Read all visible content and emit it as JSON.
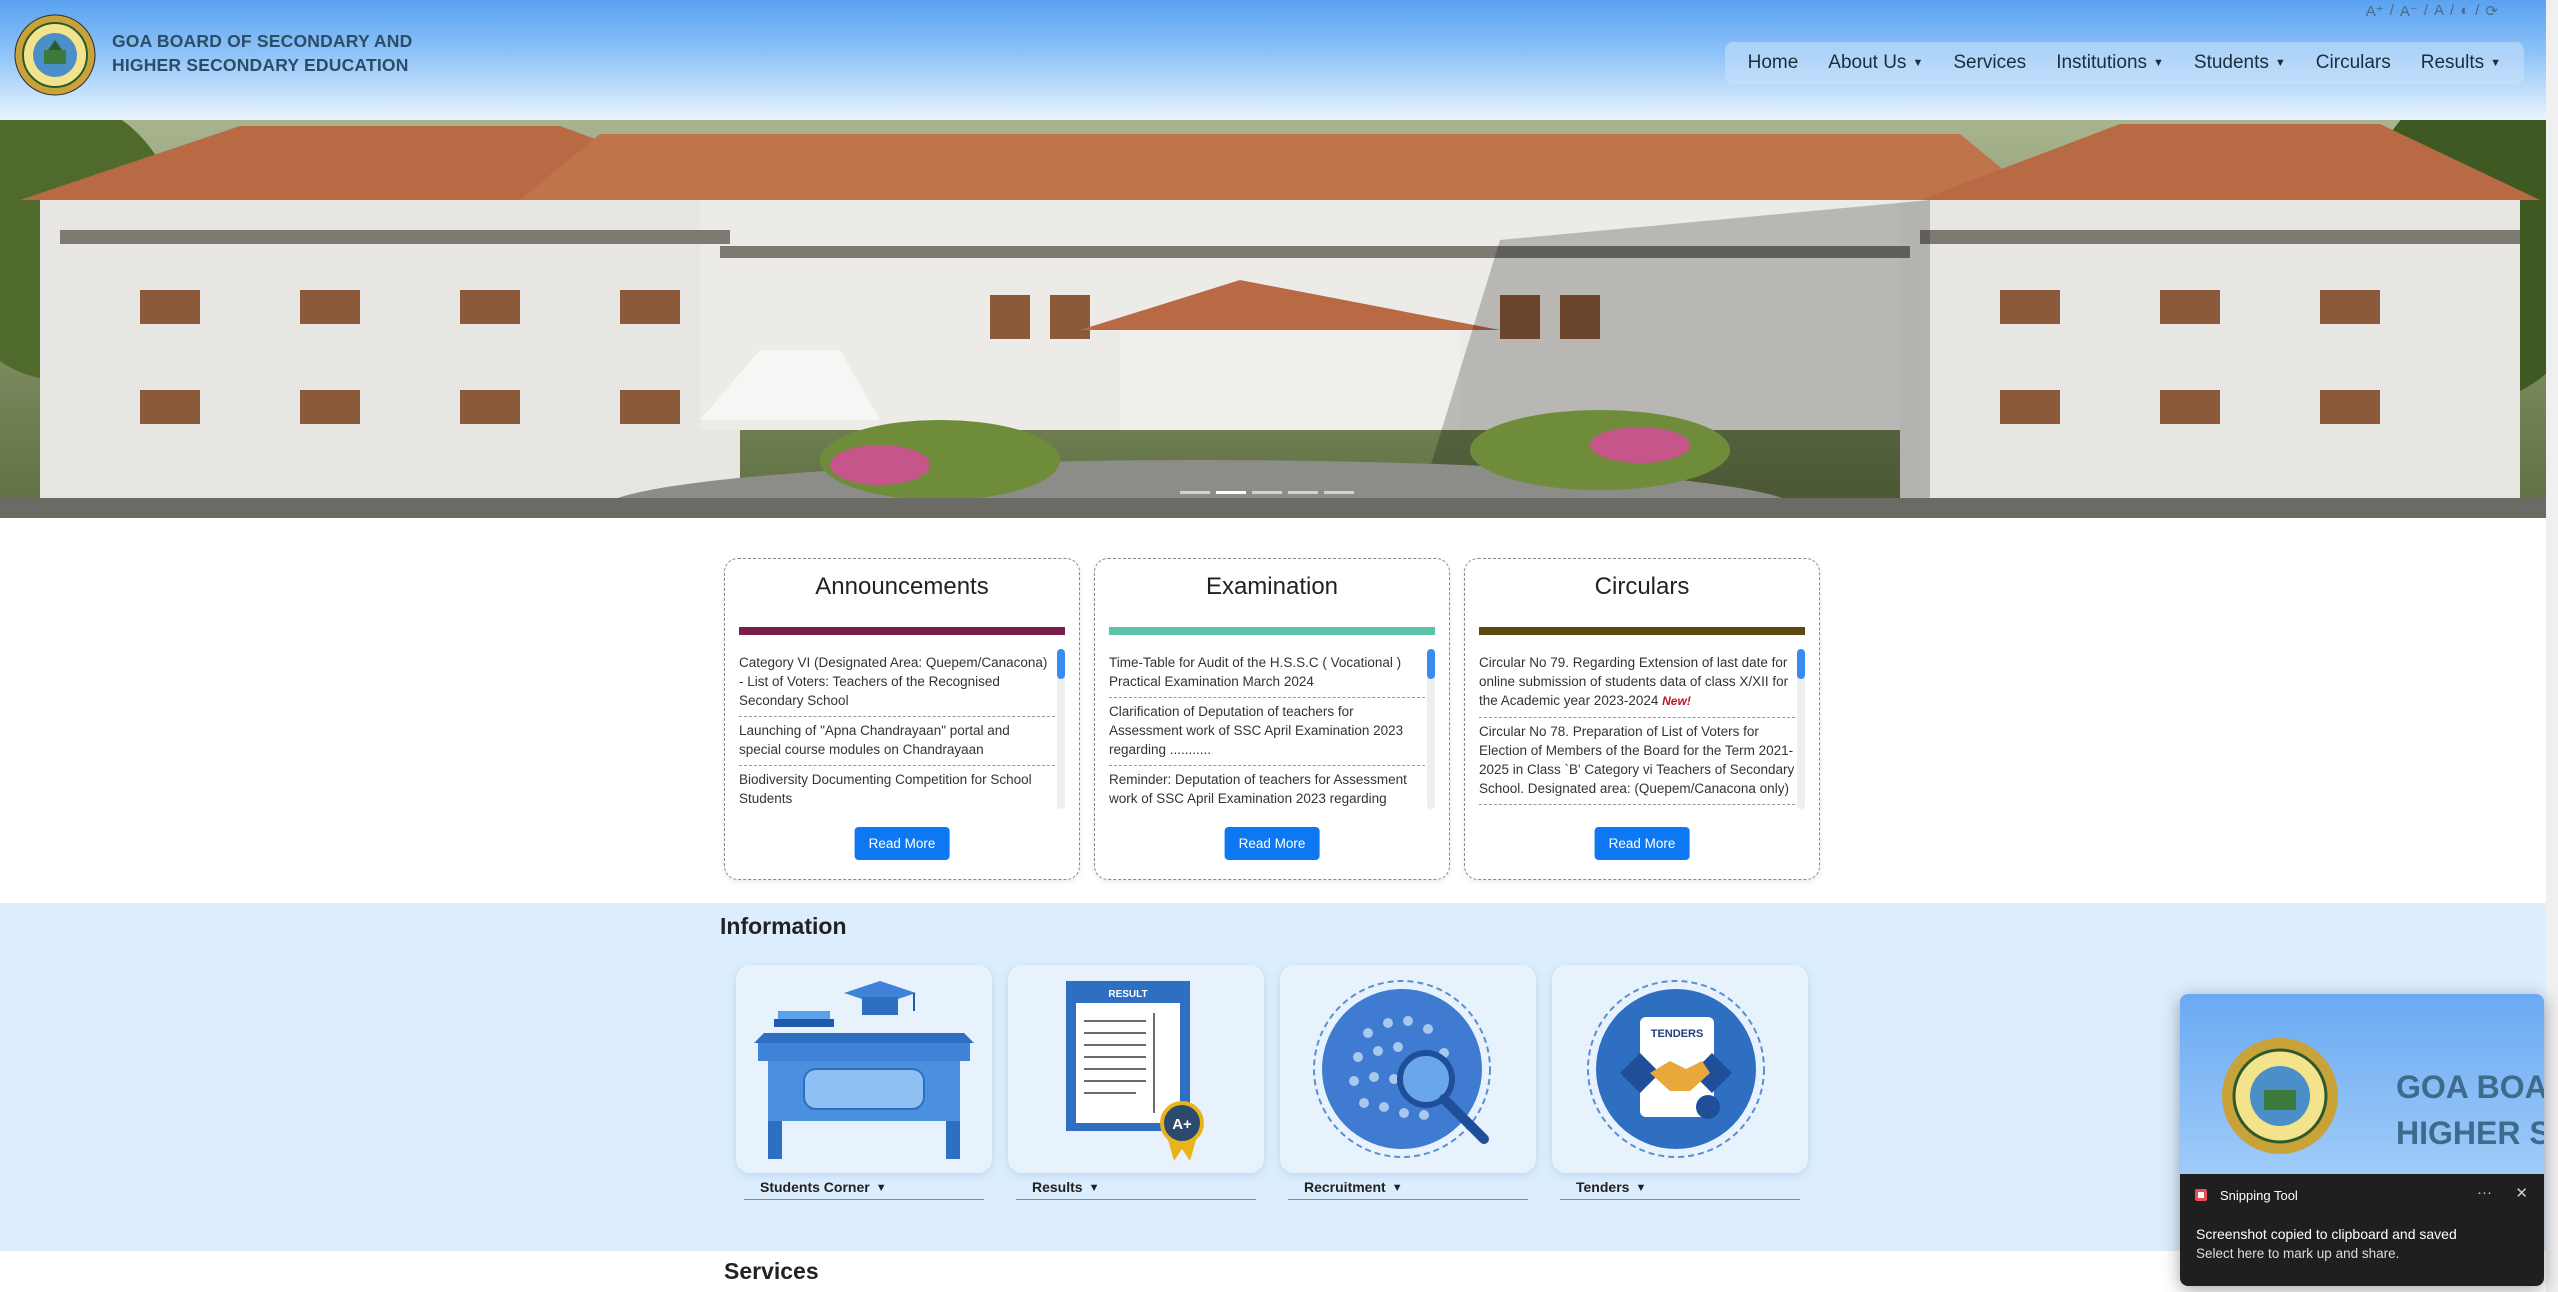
{
  "header": {
    "org_name_line1": "GOA BOARD OF SECONDARY AND",
    "org_name_line2": "HIGHER SECONDARY EDUCATION",
    "a11y": [
      "A⁺",
      "/",
      "A⁻",
      "/",
      "A",
      "/",
      "◐",
      "/",
      "⟳"
    ],
    "nav": [
      "Home",
      "About Us",
      "Services",
      "Institutions",
      "Students",
      "Circulars",
      "Results"
    ]
  },
  "announcements": {
    "title": "Announcements",
    "accent": "#7a1e4a",
    "items": [
      "Category VI (Designated Area: Quepem/Canacona) - List of Voters: Teachers of the Recognised Secondary School",
      "Launching of \"Apna Chandrayaan\" portal and special course modules on Chandrayaan",
      "Biodiversity Documenting Competition for School Students"
    ],
    "button": "Read More"
  },
  "examination": {
    "title": "Examination",
    "accent": "#5bc3a8",
    "items": [
      "Time-Table for Audit of the H.S.S.C ( Vocational ) Practical Examination March 2024",
      "Clarification of Deputation of teachers for Assessment work of SSC April Examination 2023 regarding ...........",
      "Reminder: Deputation of teachers for Assessment work of SSC April Examination 2023 regarding"
    ],
    "button": "Read More"
  },
  "circulars": {
    "title": "Circulars",
    "accent": "#5c4a10",
    "items": [
      "Circular No 79. Regarding Extension of last date for online submission of students data of class X/XII for the Academic year 2023-2024",
      "Circular No 78. Preparation of List of Voters for Election of Members of the Board for the Term 2021-2025 in Class `B' Category vi Teachers of Secondary School. Designated area: (Quepem/Canacona only)"
    ],
    "new_badge": "New!",
    "button": "Read More"
  },
  "information": {
    "title": "Information",
    "tiles": [
      "Students Corner",
      "Results",
      "Recruitment",
      "Tenders"
    ],
    "result_doc_label": "RESULT",
    "grade_label": "A+",
    "tenders_label": "TENDERS"
  },
  "services": {
    "title": "Services"
  },
  "toast": {
    "app": "Snipping Tool",
    "more": "···",
    "close": "✕",
    "title": "Screenshot copied to clipboard and saved",
    "subtitle": "Select here to mark up and share.",
    "preview_line1": "GOA BOA",
    "preview_line2": "HIGHER S"
  }
}
